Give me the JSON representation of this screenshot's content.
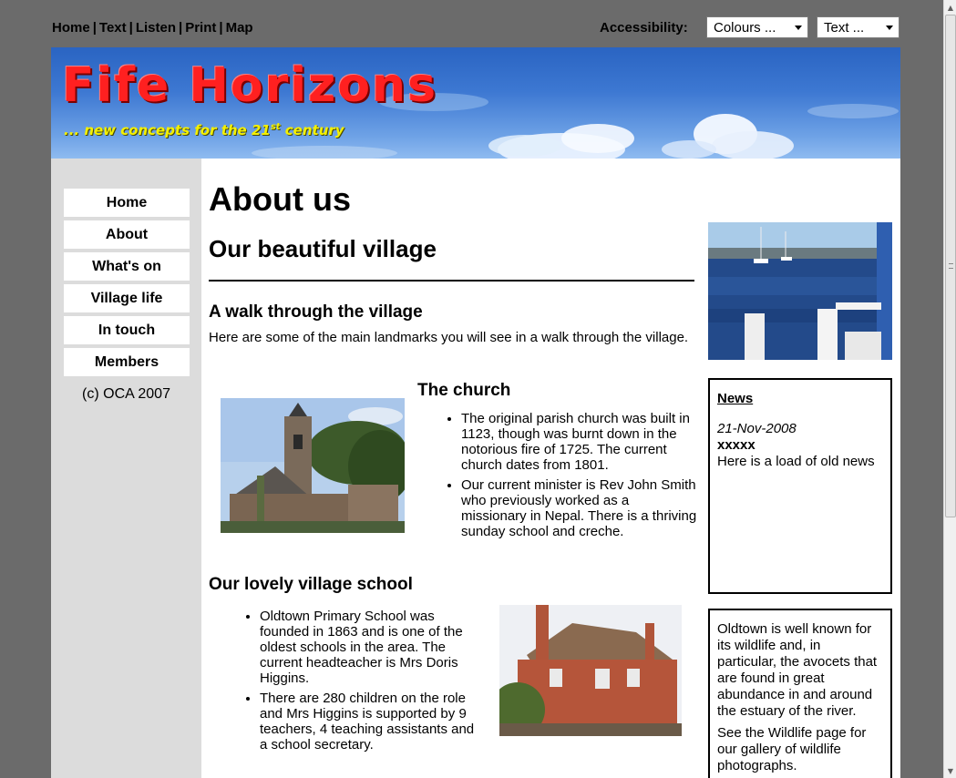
{
  "topbar": {
    "links": [
      "Home",
      "Text",
      "Listen",
      "Print",
      "Map"
    ],
    "separator": "|",
    "accessibility_label": "Accessibility:",
    "colours_select": "Colours ...",
    "text_select": "Text ..."
  },
  "banner": {
    "title": "Fife Horizons",
    "tagline_prefix": "... new concepts for the 21",
    "tagline_sup": "st",
    "tagline_suffix": " century"
  },
  "nav": {
    "items": [
      "Home",
      "About",
      "What's on",
      "Village life",
      "In touch",
      "Members"
    ],
    "copyright": "(c) OCA 2007"
  },
  "main": {
    "heading": "About us",
    "subheading": "Our beautiful village",
    "walk_heading": "A walk through the village",
    "walk_text": "Here are some of the main landmarks you will see in a walk through the village.",
    "church_heading": "The church",
    "church_points": [
      "The original parish church was built in 1123, though was burnt down in the notorious fire of 1725. The current church dates from 1801.",
      "Our current minister is Rev John Smith who previously worked as a missionary in Nepal. There is a thriving sunday school and creche."
    ],
    "school_heading": "Our lovely village school",
    "school_points": [
      "Oldtown Primary School was founded in 1863 and is one of the oldest schools in the area. The current headteacher is Mrs Doris Higgins.",
      "There are 280 children on the role and Mrs Higgins is supported by 9 teachers, 4 teaching assistants and a school secretary."
    ]
  },
  "sidebar": {
    "news_heading": "News",
    "news_date": "21-Nov-2008",
    "news_title": "xxxxx",
    "news_body": "Here is a load of old news",
    "wildlife_p1": "Oldtown is well known for its wildlife and, in particular, the avocets that are found in great abundance in and around the estuary of the river.",
    "wildlife_p2": "See the Wildlife page for our gallery of wildlife photographs."
  }
}
